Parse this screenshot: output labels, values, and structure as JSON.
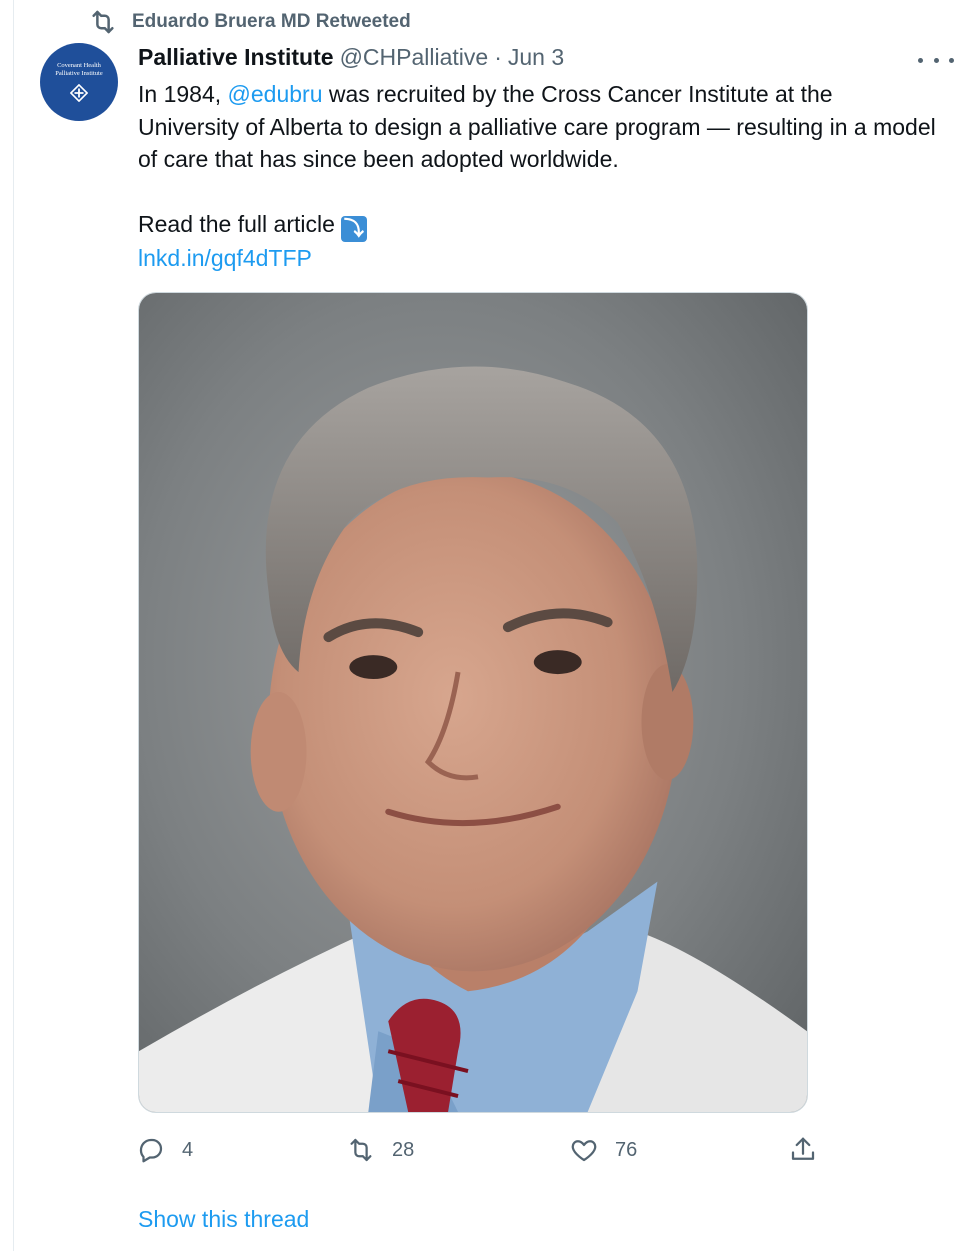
{
  "social_context": {
    "icon": "retweet-icon",
    "label": "Eduardo Bruera MD Retweeted"
  },
  "author": {
    "avatar_lines": [
      "Covenant Health",
      "Palliative Institute"
    ],
    "display_name": "Palliative Institute",
    "handle": "@CHPalliative",
    "separator": "·",
    "date": "Jun 3"
  },
  "tweet": {
    "text_before_mention": "In 1984, ",
    "mention": "@edubru",
    "text_after_mention": " was recruited by the Cross Cancer Institute at the University of Alberta to design a palliative care program — resulting in a model of care that has since been adopted worldwide.",
    "read_more": "Read the full article",
    "read_more_emoji": "⤵",
    "link": "lnkd.in/gqf4dTFP"
  },
  "actions": {
    "replies": "4",
    "retweets": "28",
    "likes": "76"
  },
  "show_thread": "Show this thread",
  "colors": {
    "accent": "#1d9bf0",
    "secondary_text": "#536471",
    "avatar_bg": "#1f4f9a"
  }
}
